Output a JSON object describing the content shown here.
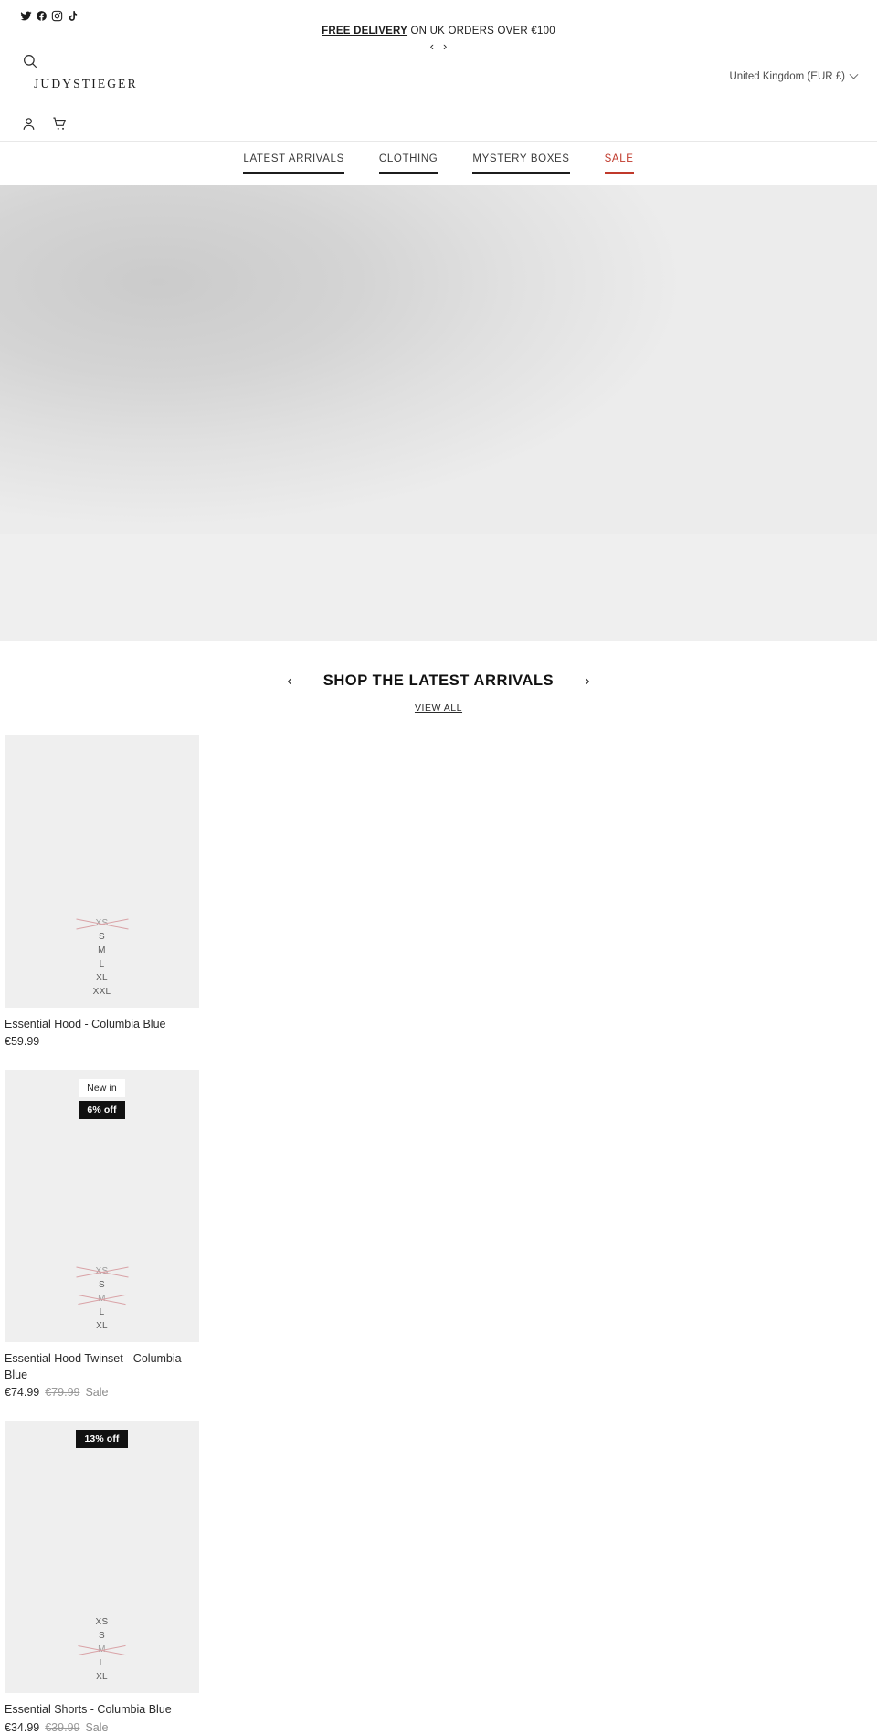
{
  "topbar": {
    "social": [
      {
        "name": "twitter-icon",
        "label": "Twitter"
      },
      {
        "name": "facebook-icon",
        "label": "Facebook"
      },
      {
        "name": "instagram-icon",
        "label": "Instagram"
      },
      {
        "name": "tiktok-icon",
        "label": "TikTok"
      }
    ],
    "announcement": {
      "bold": "FREE DELIVERY",
      "rest": " ON UK ORDERS OVER €100",
      "prev": "‹",
      "next": "›"
    },
    "locale": {
      "label": "United Kingdom (EUR £)"
    }
  },
  "header": {
    "search_label": "Search",
    "brand": "JUDYSTIEGER",
    "account_label": "Account",
    "cart_label": "Cart"
  },
  "nav": {
    "items": [
      {
        "label": "LATEST ARRIVALS",
        "sale": false
      },
      {
        "label": "CLOTHING",
        "sale": false
      },
      {
        "label": "MYSTERY BOXES",
        "sale": false
      },
      {
        "label": "SALE",
        "sale": true
      }
    ]
  },
  "section": {
    "title": "SHOP THE LATEST ARRIVALS",
    "prev": "‹",
    "next": "›",
    "view_all": "VIEW ALL"
  },
  "products": [
    {
      "title": "Essential Hood - Columbia Blue",
      "price": "€59.99",
      "compare_at": "",
      "sale_label": "",
      "badges": [],
      "sizes": [
        {
          "label": "XS",
          "sold_out": true
        },
        {
          "label": "S",
          "sold_out": false
        },
        {
          "label": "M",
          "sold_out": false
        },
        {
          "label": "L",
          "sold_out": false
        },
        {
          "label": "XL",
          "sold_out": false
        },
        {
          "label": "XXL",
          "sold_out": false
        }
      ]
    },
    {
      "title": "Essential Hood Twinset - Columbia Blue",
      "price": "€74.99",
      "compare_at": "€79.99",
      "sale_label": "Sale",
      "badges": [
        {
          "text": "New in",
          "style": "new"
        },
        {
          "text": "6% off",
          "style": "off"
        }
      ],
      "sizes": [
        {
          "label": "XS",
          "sold_out": true
        },
        {
          "label": "S",
          "sold_out": false
        },
        {
          "label": "M",
          "sold_out": true
        },
        {
          "label": "L",
          "sold_out": false
        },
        {
          "label": "XL",
          "sold_out": false
        }
      ]
    },
    {
      "title": "Essential Shorts - Columbia Blue",
      "price": "€34.99",
      "compare_at": "€39.99",
      "sale_label": "Sale",
      "badges": [
        {
          "text": "13% off",
          "style": "off"
        }
      ],
      "sizes": [
        {
          "label": "XS",
          "sold_out": false
        },
        {
          "label": "S",
          "sold_out": false
        },
        {
          "label": "M",
          "sold_out": true
        },
        {
          "label": "L",
          "sold_out": false
        },
        {
          "label": "XL",
          "sold_out": false
        }
      ]
    }
  ],
  "colors": {
    "sale_red": "#c0392b",
    "badge_dark": "#111111",
    "placeholder_grey": "#efefef"
  }
}
